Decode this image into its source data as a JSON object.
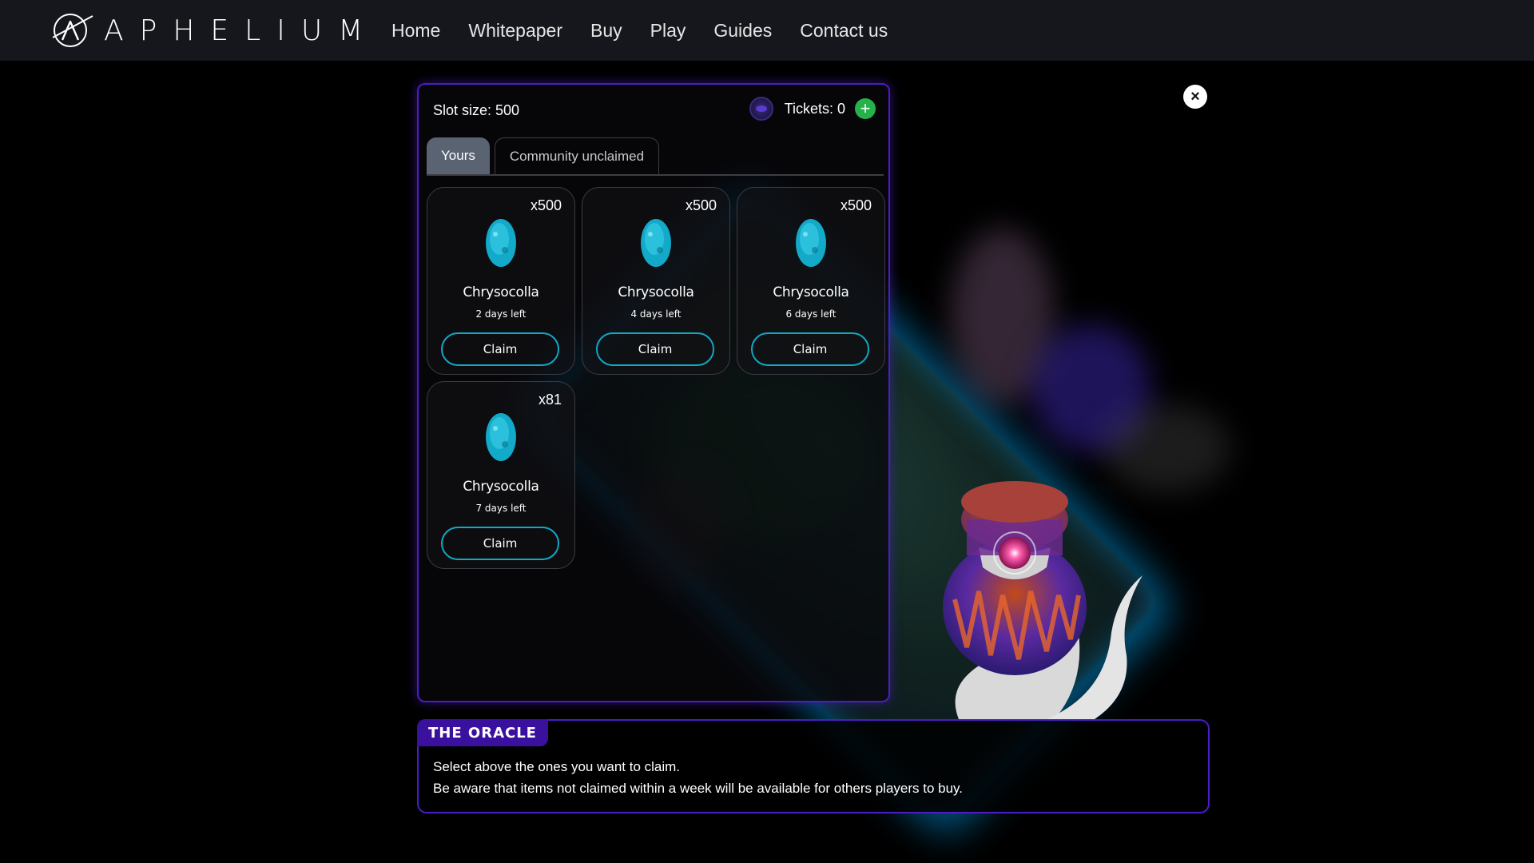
{
  "brand": {
    "name": "APHELIUM"
  },
  "nav": {
    "items": [
      "Home",
      "Whitepaper",
      "Buy",
      "Play",
      "Guides",
      "Contact us"
    ]
  },
  "panel": {
    "slot_size": "Slot size: 500",
    "tickets_label": "Tickets: 0",
    "add_ticket_symbol": "+",
    "tabs": [
      {
        "label": "Yours",
        "active": true
      },
      {
        "label": "Community unclaimed",
        "active": false
      }
    ],
    "items": [
      {
        "count": "x500",
        "name": "Chrysocolla",
        "days": "2 days left",
        "button": "Claim"
      },
      {
        "count": "x500",
        "name": "Chrysocolla",
        "days": "4 days left",
        "button": "Claim"
      },
      {
        "count": "x500",
        "name": "Chrysocolla",
        "days": "6 days left",
        "button": "Claim"
      },
      {
        "count": "x81",
        "name": "Chrysocolla",
        "days": "7 days left",
        "button": "Claim"
      }
    ]
  },
  "close_symbol": "×",
  "oracle": {
    "title": "THE ORACLE",
    "lines": [
      "Select above the ones you want to claim.",
      "Be aware that items not claimed within a week will be available for others players to buy."
    ]
  },
  "icons": {
    "logo": "aphelium-logo-icon",
    "ticket": "ticket-coin-icon",
    "add": "plus-icon",
    "close": "close-icon",
    "gem": "chrysocolla-gem-icon"
  },
  "colors": {
    "navbar_bg": "#16161d",
    "panel_border": "#4b1cc7",
    "oracle_tag_bg": "#3a119e",
    "tab_active_bg": "#5a6372",
    "claim_border": "#13a7c4",
    "add_button": "#25b24a",
    "gem": "#1fb4d0"
  }
}
